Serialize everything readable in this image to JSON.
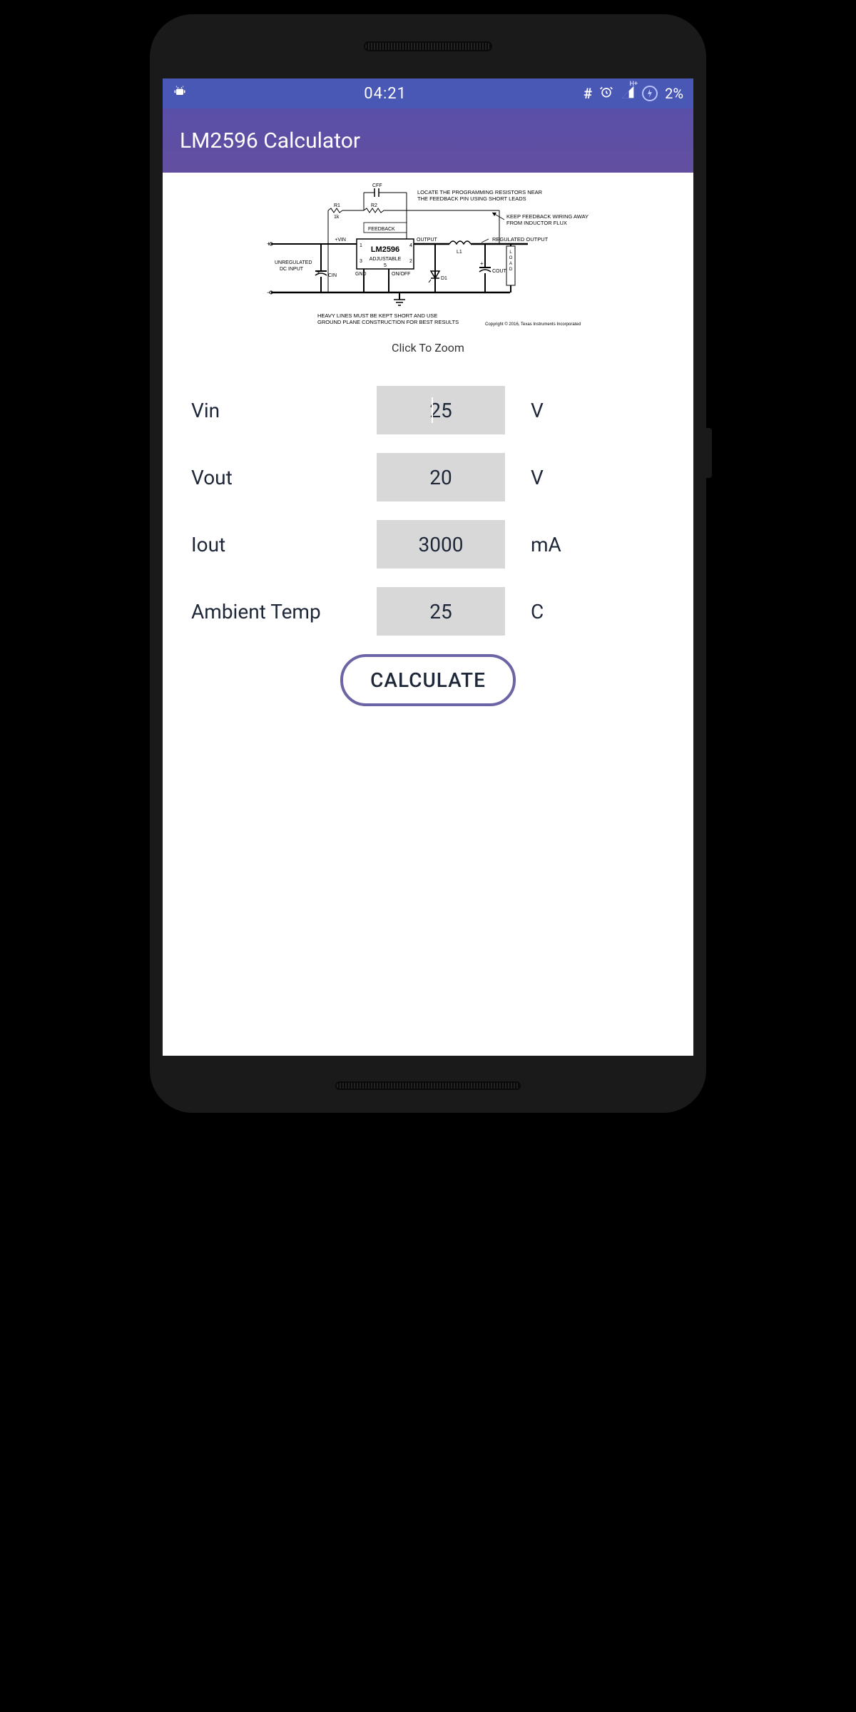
{
  "status": {
    "time": "04:21",
    "battery_pct": "2%"
  },
  "app": {
    "title": "LM2596 Calculator"
  },
  "diagram": {
    "caption": "Click To Zoom",
    "chip_label": "LM2596",
    "chip_sub": "ADJUSTABLE",
    "labels": {
      "cff": "CFF",
      "r1": "R1",
      "r1_val": "1k",
      "r2": "R2",
      "feedback": "FEEDBACK",
      "vin": "+VIN",
      "output": "OUTPUT",
      "gnd": "GND",
      "onoff": "ON/OFF",
      "cin": "CIN",
      "cout": "COUT",
      "d1": "D1",
      "l1": "L1",
      "load": "LOAD",
      "unreg": "UNREGULATED\nDC INPUT",
      "regout": "REGULATED OUTPUT",
      "note1": "LOCATE THE PROGRAMMING RESISTORS NEAR\nTHE FEEDBACK PIN USING SHORT LEADS",
      "note2": "KEEP FEEDBACK WIRING AWAY\nFROM INDUCTOR FLUX",
      "note3": "HEAVY LINES MUST BE KEPT SHORT AND USE\nGROUND PLANE CONSTRUCTION FOR BEST RESULTS",
      "copyright": "Copyright © 2016, Texas Instruments Incorporated",
      "pin1": "1",
      "pin2": "2",
      "pin3": "3",
      "pin4": "4",
      "pin5": "5"
    }
  },
  "form": {
    "rows": [
      {
        "label": "Vin",
        "value": "25",
        "unit": "V"
      },
      {
        "label": "Vout",
        "value": "20",
        "unit": "V"
      },
      {
        "label": "Iout",
        "value": "3000",
        "unit": "mA"
      },
      {
        "label": "Ambient Temp",
        "value": "25",
        "unit": "C"
      }
    ],
    "calculate_label": "CALCULATE"
  }
}
